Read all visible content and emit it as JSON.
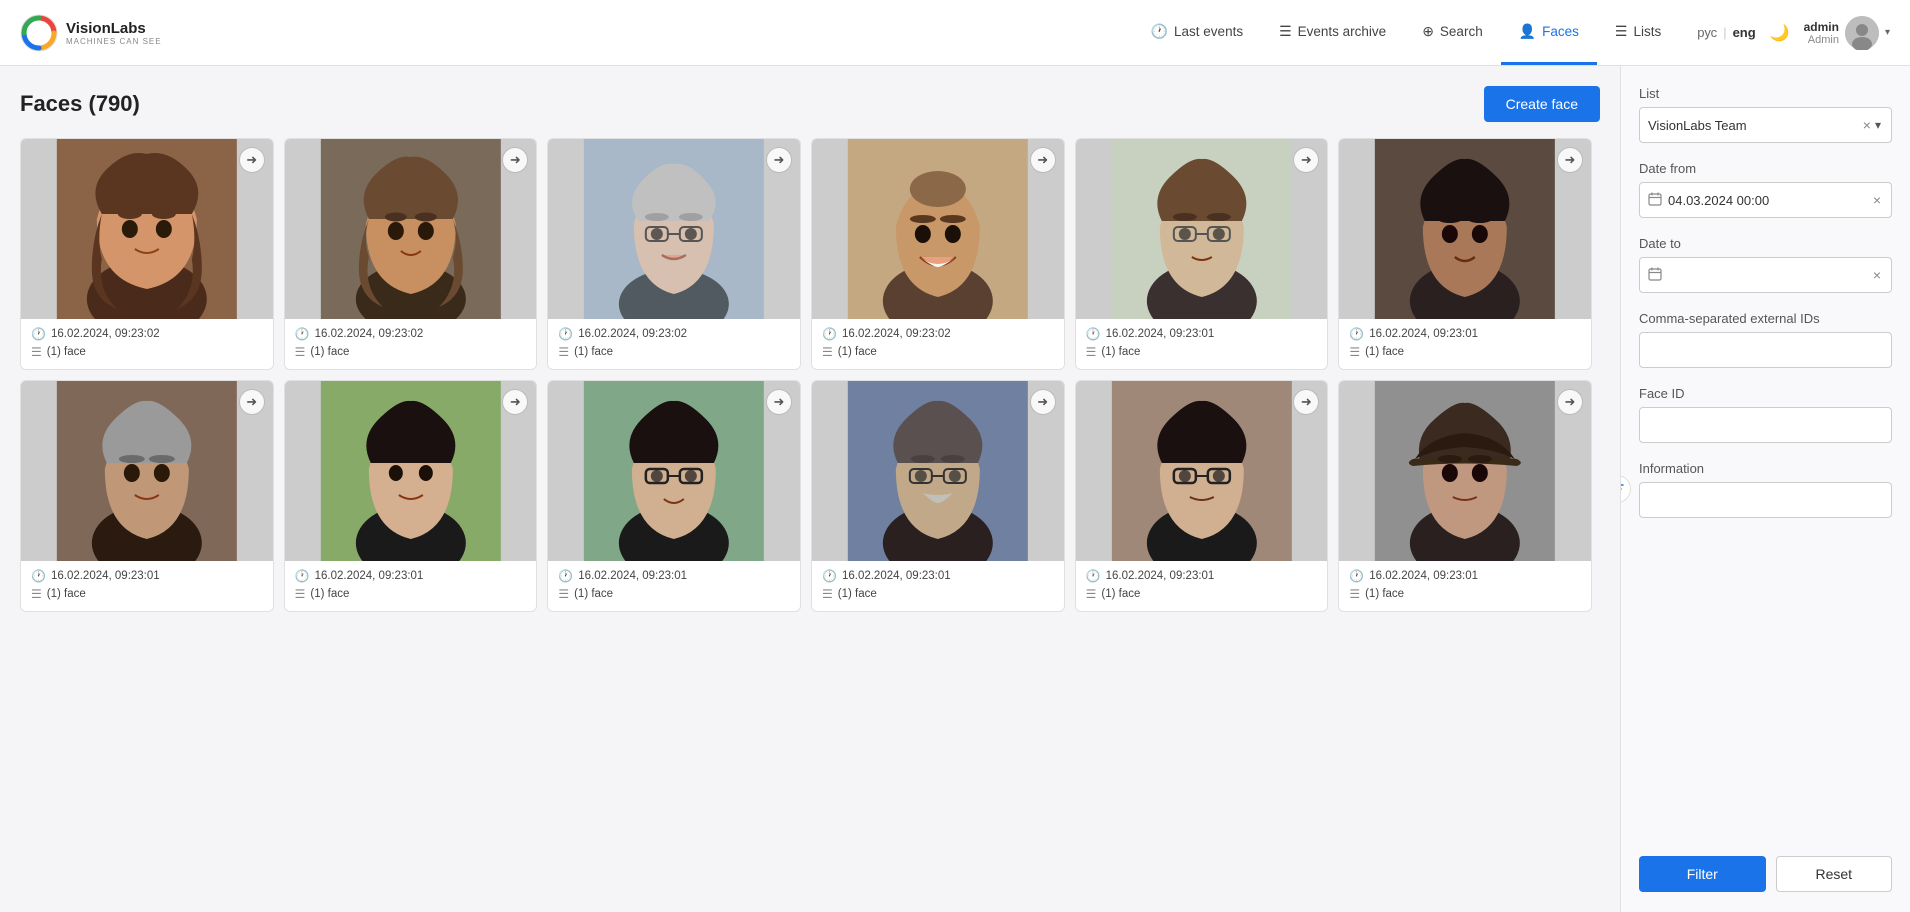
{
  "app": {
    "name": "VisionLabs",
    "tagline": "MACHINES CAN SEE"
  },
  "nav": {
    "items": [
      {
        "id": "last-events",
        "label": "Last events",
        "icon": "🕐",
        "active": false
      },
      {
        "id": "events-archive",
        "label": "Events archive",
        "icon": "≡",
        "active": false
      },
      {
        "id": "search",
        "label": "Search",
        "icon": "⊕",
        "active": false
      },
      {
        "id": "faces",
        "label": "Faces",
        "icon": "👤",
        "active": true
      },
      {
        "id": "lists",
        "label": "Lists",
        "icon": "≡",
        "active": false
      }
    ]
  },
  "lang": {
    "options": [
      "рус",
      "eng"
    ],
    "active": "eng"
  },
  "user": {
    "name": "admin",
    "role": "Admin"
  },
  "page": {
    "title": "Faces (790)",
    "create_button": "Create face"
  },
  "faces": [
    {
      "id": 1,
      "date": "16.02.2024, 09:23:02",
      "list_count": 1,
      "list_label": "face",
      "bg": "#c9a090"
    },
    {
      "id": 2,
      "date": "16.02.2024, 09:23:02",
      "list_count": 1,
      "list_label": "face",
      "bg": "#b09070"
    },
    {
      "id": 3,
      "date": "16.02.2024, 09:23:02",
      "list_count": 1,
      "list_label": "face",
      "bg": "#b0b8c8"
    },
    {
      "id": 4,
      "date": "16.02.2024, 09:23:02",
      "list_count": 1,
      "list_label": "face",
      "bg": "#c4a882"
    },
    {
      "id": 5,
      "date": "16.02.2024, 09:23:01",
      "list_count": 1,
      "list_label": "face",
      "bg": "#b0b8b0"
    },
    {
      "id": 6,
      "date": "16.02.2024, 09:23:01",
      "list_count": 1,
      "list_label": "face",
      "bg": "#908070"
    },
    {
      "id": 7,
      "date": "16.02.2024, 09:23:01",
      "list_count": 1,
      "list_label": "face",
      "bg": "#706050"
    },
    {
      "id": 8,
      "date": "16.02.2024, 09:23:01",
      "list_count": 1,
      "list_label": "face",
      "bg": "#98b87a"
    },
    {
      "id": 9,
      "date": "16.02.2024, 09:23:01",
      "list_count": 1,
      "list_label": "face",
      "bg": "#a0c0a0"
    },
    {
      "id": 10,
      "date": "16.02.2024, 09:23:01",
      "list_count": 1,
      "list_label": "face",
      "bg": "#7890b0"
    },
    {
      "id": 11,
      "date": "16.02.2024, 09:23:01",
      "list_count": 1,
      "list_label": "face",
      "bg": "#a08878"
    },
    {
      "id": 12,
      "date": "16.02.2024, 09:23:01",
      "list_count": 1,
      "list_label": "face",
      "bg": "#909090"
    }
  ],
  "filter": {
    "list_label": "List",
    "list_value": "VisionLabs Team",
    "date_from_label": "Date from",
    "date_from_value": "04.03.2024 00:00",
    "date_to_label": "Date to",
    "date_to_value": "",
    "external_ids_label": "Comma-separated external IDs",
    "face_id_label": "Face ID",
    "information_label": "Information",
    "filter_btn": "Filter",
    "reset_btn": "Reset"
  }
}
